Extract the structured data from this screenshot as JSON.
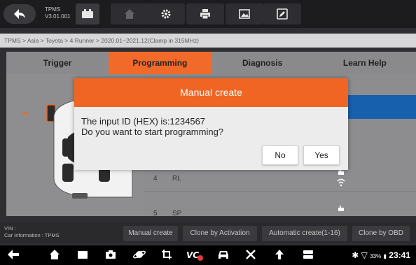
{
  "app": {
    "name": "TPMS",
    "version": "V3.01.001"
  },
  "breadcrumb": "TPMS > Asia > Toyota > 4 Runner > 2020.01~2021.12(Clamp in 315MHz)",
  "tabs": [
    {
      "label": "Trigger",
      "active": false
    },
    {
      "label": "Programming",
      "active": true
    },
    {
      "label": "Diagnosis",
      "active": false
    },
    {
      "label": "Learn Help",
      "active": false
    }
  ],
  "sensor_list": [
    {
      "num": "4",
      "label": "RL"
    },
    {
      "num": "5",
      "label": "SP"
    }
  ],
  "dialog": {
    "title": "Manual create",
    "line1": "The input ID (HEX) is:1234567",
    "line2": "Do you want to start programming?",
    "no_label": "No",
    "yes_label": "Yes"
  },
  "footer": {
    "vin_label": "VIN :",
    "car_info": "Car Information : TPMS",
    "buttons": [
      "Manual create",
      "Clone by Activation",
      "Automatic create(1-16)",
      "Clone by OBD"
    ]
  },
  "status_bar": {
    "battery": "33%",
    "time": "23:41"
  },
  "colors": {
    "accent": "#f06524",
    "highlight": "#1760ae"
  }
}
